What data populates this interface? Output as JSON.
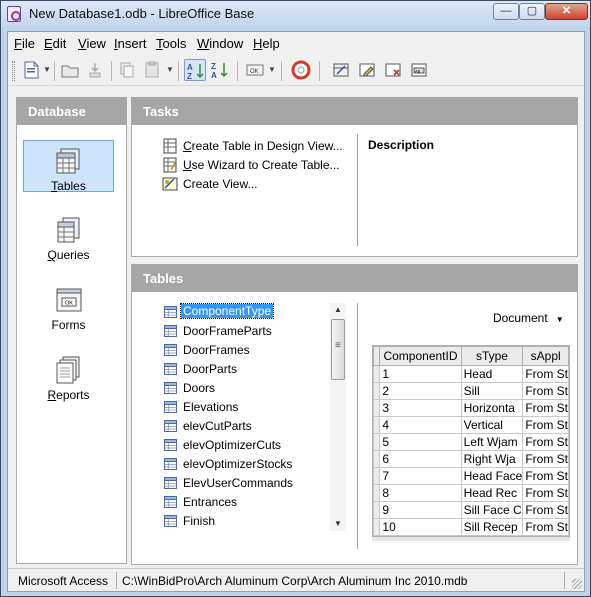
{
  "window": {
    "title": "New Database1.odb - LibreOffice Base"
  },
  "menu": [
    {
      "label": "File",
      "accel": "F",
      "rest": "ile"
    },
    {
      "label": "Edit",
      "accel": "E",
      "rest": "dit"
    },
    {
      "label": "View",
      "accel": "V",
      "rest": "iew"
    },
    {
      "label": "Insert",
      "accel": "I",
      "rest": "nsert"
    },
    {
      "label": "Tools",
      "accel": "T",
      "rest": "ools"
    },
    {
      "label": "Window",
      "accel": "W",
      "rest": "indow"
    },
    {
      "label": "Help",
      "accel": "H",
      "rest": "elp"
    }
  ],
  "database_pane": {
    "header": "Database",
    "items": [
      {
        "accel": "T",
        "rest": "ables",
        "icon": "tables-icon",
        "selected": true
      },
      {
        "accel": "Q",
        "rest": "ueries",
        "icon": "queries-icon",
        "selected": false
      },
      {
        "accel": "",
        "rest": "Forms",
        "icon": "forms-icon",
        "selected": false
      },
      {
        "accel": "R",
        "rest": "eports",
        "icon": "reports-icon",
        "selected": false
      }
    ]
  },
  "tasks_pane": {
    "header": "Tasks",
    "tasks": [
      {
        "accel": "C",
        "rest": "reate Table in Design View...",
        "icon": "design-view-icon"
      },
      {
        "accel": "U",
        "rest": "se Wizard to Create Table...",
        "icon": "wizard-icon"
      },
      {
        "accel": "",
        "rest": "Create View...",
        "icon": "create-view-icon"
      }
    ],
    "description_label": "Description"
  },
  "tables_pane": {
    "header": "Tables",
    "tables": [
      "ComponentType",
      "DoorFrameParts",
      "DoorFrames",
      "DoorParts",
      "Doors",
      "Elevations",
      "elevCutParts",
      "elevOptimizerCuts",
      "elevOptimizerStocks",
      "ElevUserCommands",
      "Entrances",
      "Finish"
    ],
    "selected_index": 0,
    "preview_mode": "Document",
    "preview": {
      "columns": [
        "",
        "ComponentID",
        "sType",
        "sAppl"
      ],
      "rows": [
        [
          "1",
          "Head",
          "From St"
        ],
        [
          "2",
          "Sill",
          "From St"
        ],
        [
          "3",
          "Horizonta",
          "From St"
        ],
        [
          "4",
          "Vertical",
          "From St"
        ],
        [
          "5",
          "Left Wjam",
          "From St"
        ],
        [
          "6",
          "Right Wja",
          "From St"
        ],
        [
          "7",
          "Head Face",
          "From St"
        ],
        [
          "8",
          "Head Rec",
          "From St"
        ],
        [
          "9",
          "Sill Face C",
          "From St"
        ],
        [
          "10",
          "Sill Recep",
          "From St"
        ]
      ]
    }
  },
  "status": {
    "db_type": "Microsoft Access",
    "path": "C:\\WinBidPro\\Arch Aluminum Corp\\Arch Aluminum Inc 2010.mdb"
  }
}
